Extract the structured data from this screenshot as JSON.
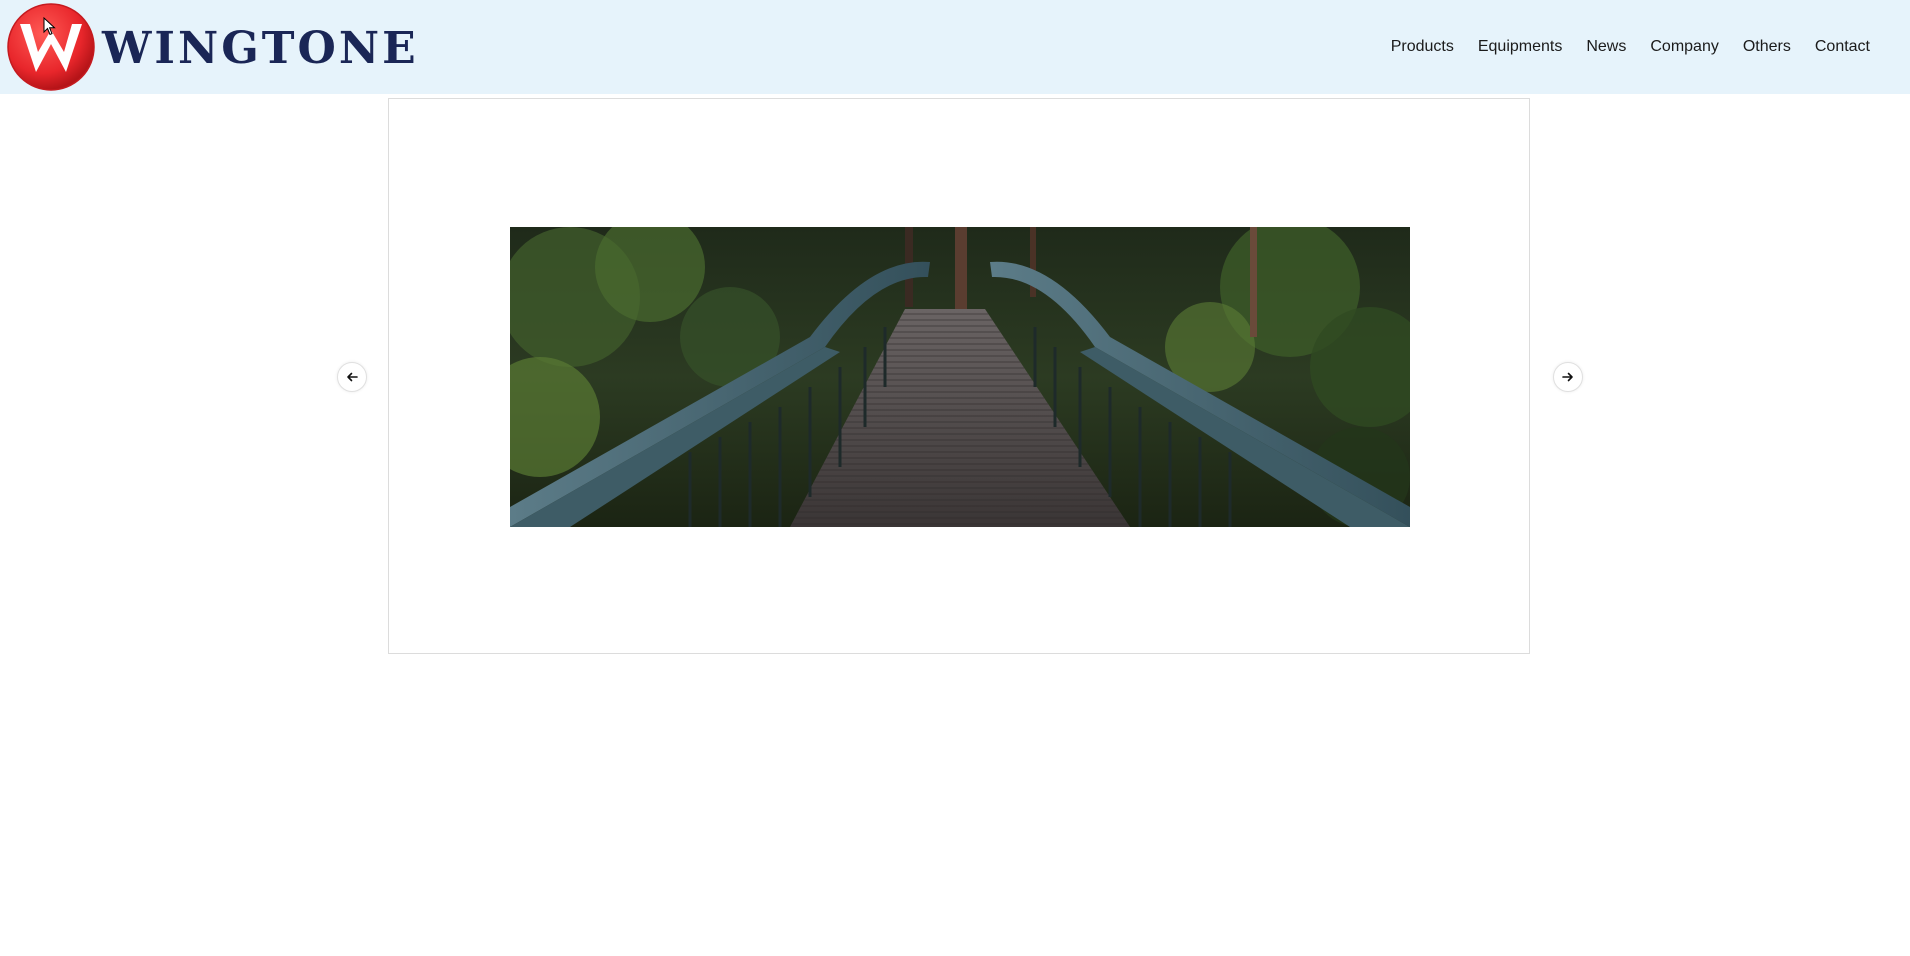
{
  "brand": {
    "name": "WINGTONE",
    "logo_icon": "wingtone-w-logo-icon",
    "logo_color": "#e8262b",
    "text_color": "#1a2656"
  },
  "nav": {
    "items": [
      {
        "label": "Products"
      },
      {
        "label": "Equipments"
      },
      {
        "label": "News"
      },
      {
        "label": "Company"
      },
      {
        "label": "Others"
      },
      {
        "label": "Contact"
      }
    ]
  },
  "slider": {
    "image_subject": "forest-footbridge-photo",
    "prev_icon": "arrow-left-icon",
    "next_icon": "arrow-right-icon"
  },
  "colors": {
    "header_bg": "#e6f3fb",
    "page_bg": "#ffffff",
    "frame_border": "#dcdcdc"
  }
}
